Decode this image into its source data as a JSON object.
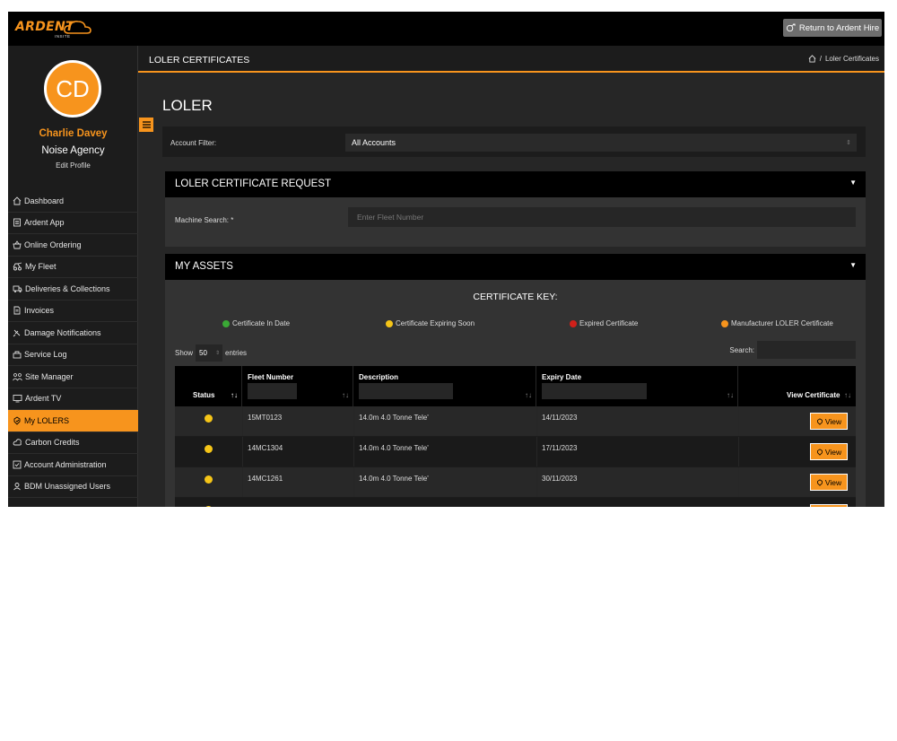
{
  "header": {
    "logo_text": "ARDENT",
    "logo_sub": "INSITE",
    "return_label": "Return to Ardent Hire"
  },
  "user": {
    "initials": "CD",
    "name": "Charlie Davey",
    "org": "Noise Agency",
    "edit_label": "Edit Profile"
  },
  "sidebar": {
    "items": [
      {
        "label": "Dashboard",
        "icon": "home-icon"
      },
      {
        "label": "Ardent App",
        "icon": "app-icon"
      },
      {
        "label": "Online Ordering",
        "icon": "basket-icon"
      },
      {
        "label": "My Fleet",
        "icon": "fleet-icon"
      },
      {
        "label": "Deliveries & Collections",
        "icon": "truck-icon"
      },
      {
        "label": "Invoices",
        "icon": "invoice-icon"
      },
      {
        "label": "Damage Notifications",
        "icon": "damage-icon"
      },
      {
        "label": "Service Log",
        "icon": "service-icon"
      },
      {
        "label": "Site Manager",
        "icon": "site-icon"
      },
      {
        "label": "Ardent TV",
        "icon": "tv-icon"
      },
      {
        "label": "My LOLERS",
        "icon": "certificate-icon",
        "active": true
      },
      {
        "label": "Carbon Credits",
        "icon": "carbon-icon"
      },
      {
        "label": "Account Administration",
        "icon": "admin-icon"
      },
      {
        "label": "BDM Unassigned Users",
        "icon": "user-icon"
      }
    ]
  },
  "page": {
    "header_title": "LOLER CERTIFICATES",
    "breadcrumb_current": "Loler Certificates",
    "breadcrumb_sep": "/",
    "heading": "LOLER"
  },
  "filter": {
    "label": "Account Filter:",
    "value": "All Accounts"
  },
  "request": {
    "title": "LOLER CERTIFICATE REQUEST",
    "label": "Machine Search: *",
    "placeholder": "Enter Fleet Number"
  },
  "assets": {
    "title": "MY ASSETS",
    "key_title": "CERTIFICATE KEY:",
    "key": [
      {
        "label": "Certificate In Date",
        "color": "#3aa935"
      },
      {
        "label": "Certificate Expiring Soon",
        "color": "#f5c518"
      },
      {
        "label": "Expired Certificate",
        "color": "#d0201a"
      },
      {
        "label": "Manufacturer LOLER Certificate",
        "color": "#f7941d"
      }
    ],
    "show_label": "Show",
    "entries_value": "50",
    "entries_label": "entries",
    "search_label": "Search:",
    "columns": [
      "Status",
      "Fleet Number",
      "Description",
      "Expiry Date",
      "View Certificate"
    ],
    "view_label": "View",
    "rows": [
      {
        "fleet": "15MT0123",
        "description": "14.0m 4.0 Tonne Tele'",
        "expiry": "14/11/2023",
        "status_color": "#f5c518"
      },
      {
        "fleet": "14MC1304",
        "description": "14.0m 4.0 Tonne Tele'",
        "expiry": "17/11/2023",
        "status_color": "#f5c518"
      },
      {
        "fleet": "14MC1261",
        "description": "14.0m 4.0 Tonne Tele'",
        "expiry": "30/11/2023",
        "status_color": "#f5c518"
      }
    ]
  }
}
